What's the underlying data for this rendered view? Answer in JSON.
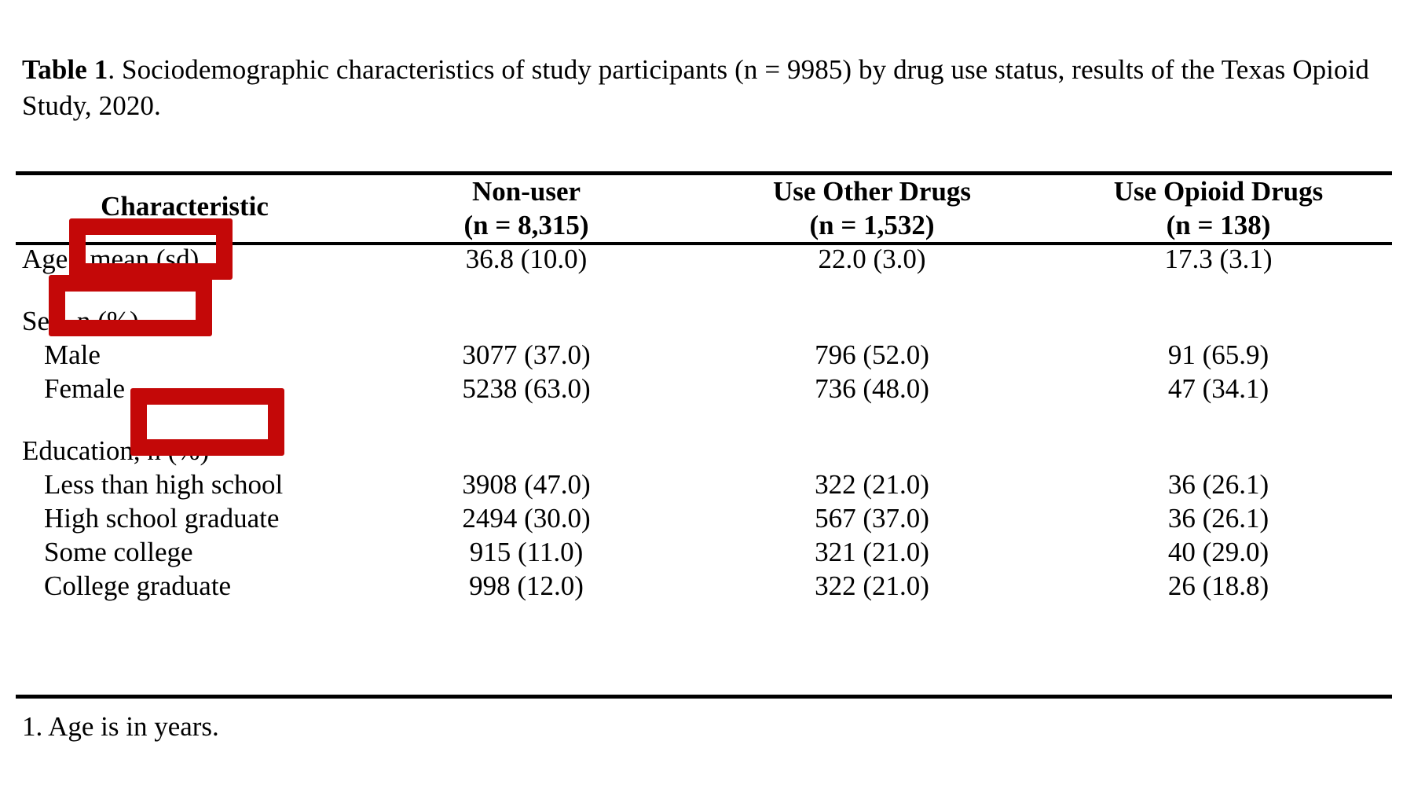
{
  "document": {
    "caption": {
      "label": "Table 1",
      "text": ". Sociodemographic characteristics of study participants (n = 9985) by drug use status, results of the Texas Opioid Study, 2020."
    },
    "footnote": "1. Age is in years."
  },
  "table": {
    "columns": [
      {
        "key": "characteristic",
        "title": "Characteristic",
        "subtitle": ""
      },
      {
        "key": "nonuser",
        "title": "Non-user",
        "subtitle": "(n = 8,315)"
      },
      {
        "key": "other_drugs",
        "title": "Use Other Drugs",
        "subtitle": "(n = 1,532)"
      },
      {
        "key": "opioid_drugs",
        "title": "Use Opioid Drugs",
        "subtitle": "(n = 138)"
      }
    ],
    "rows": [
      {
        "label": "Age",
        "footnote_marker": "1",
        "label_suffix": ", mean (sd)",
        "indent": false,
        "values": [
          "36.8 (10.0)",
          "22.0 (3.0)",
          "17.3 (3.1)"
        ]
      },
      {
        "label": "Sex, n (%)",
        "indent": false,
        "values": [
          "",
          "",
          ""
        ]
      },
      {
        "label": "Male",
        "indent": true,
        "values": [
          "3077 (37.0)",
          "796 (52.0)",
          "91 (65.9)"
        ]
      },
      {
        "label": "Female",
        "indent": true,
        "values": [
          "5238 (63.0)",
          "736 (48.0)",
          "47 (34.1)"
        ]
      },
      {
        "label": "Education, n (%)",
        "indent": false,
        "values": [
          "",
          "",
          ""
        ]
      },
      {
        "label": "Less than high school",
        "indent": true,
        "values": [
          "3908 (47.0)",
          "322 (21.0)",
          "36 (26.1)"
        ]
      },
      {
        "label": "High school graduate",
        "indent": true,
        "values": [
          "2494 (30.0)",
          "567 (37.0)",
          "36 (26.1)"
        ]
      },
      {
        "label": "Some college",
        "indent": true,
        "values": [
          "915 (11.0)",
          "321 (21.0)",
          "40 (29.0)"
        ]
      },
      {
        "label": "College graduate",
        "indent": true,
        "values": [
          "998 (12.0)",
          "322 (21.0)",
          "26 (18.8)"
        ]
      }
    ]
  },
  "annotations": {
    "color": "#c40808",
    "boxes": [
      {
        "id": "annotation-box-age",
        "covers": "Age row label region"
      },
      {
        "id": "annotation-box-sex",
        "covers": "Sex row label region"
      },
      {
        "id": "annotation-box-education",
        "covers": "Education row label region"
      }
    ]
  }
}
